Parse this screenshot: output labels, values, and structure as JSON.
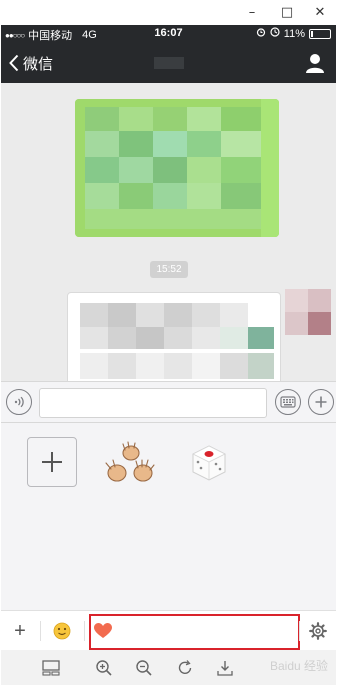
{
  "window": {
    "minimize_label": "–",
    "maximize_label": "□",
    "close_label": "✕"
  },
  "statusbar": {
    "carrier": "中国移动",
    "network": "4G",
    "time": "16:07",
    "battery_percent": "11%",
    "battery_level": 0.11
  },
  "navbar": {
    "back_label": "微信"
  },
  "chat": {
    "timestamp": "15:52"
  },
  "tabbar": {
    "add_label": "+"
  },
  "watermark": "Baidu 经验",
  "colors": {
    "top_bar": "#27292c",
    "chat_background": "#ebebeb",
    "bubble_green": "#9fe65f",
    "highlight": "#d9232b"
  },
  "icons": [
    "back-chevron-icon",
    "user-icon",
    "voice-icon",
    "keyboard-icon",
    "plus-circle-icon",
    "rock-paper-scissors-icon",
    "dice-icon",
    "emoji-icon",
    "heart-icon",
    "settings-gear-icon",
    "layout-icon",
    "zoom-in-icon",
    "zoom-out-icon",
    "rotate-icon",
    "download-icon"
  ]
}
